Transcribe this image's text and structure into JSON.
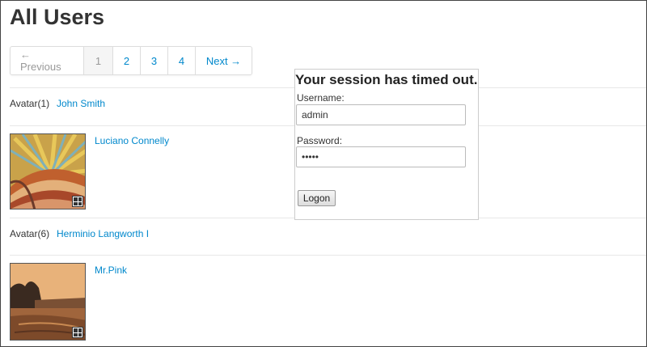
{
  "page": {
    "title": "All Users"
  },
  "pagination": {
    "previous": "← Previous",
    "pages": [
      "1",
      "2",
      "3",
      "4"
    ],
    "active_page": "1",
    "next": "Next →"
  },
  "users": [
    {
      "avatar_label": "Avatar(1)",
      "name": "John Smith"
    },
    {
      "avatar_image": "sunrise-fields-painting",
      "name": "Luciano Connelly"
    },
    {
      "avatar_label": "Avatar(6)",
      "name": "Herminio Langworth I"
    },
    {
      "avatar_image": "sepia-landscape-painting",
      "name": "Mr.Pink"
    }
  ],
  "session_dialog": {
    "message": "Your session has timed out.",
    "username_label": "Username:",
    "username_value": "admin",
    "password_label": "Password:",
    "password_value": "•••••",
    "logon_label": "Logon"
  },
  "icons": {
    "expand": "expand-icon"
  },
  "colors": {
    "link": "#0088cc",
    "text": "#333333",
    "border": "#dddddd"
  }
}
